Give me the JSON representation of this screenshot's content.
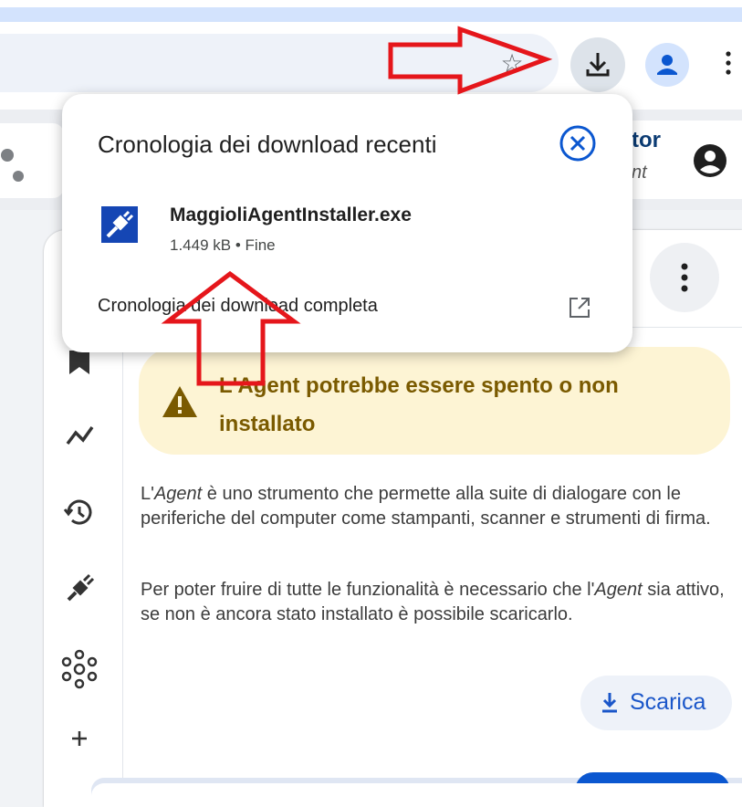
{
  "colors": {
    "accent_blue": "#1a56c9",
    "warning_bg": "#fdf4d4",
    "warning_text": "#7a5a00",
    "annotation_red": "#e5161b"
  },
  "toolbar": {
    "bookmark_icon": "star-outline-icon",
    "download_icon": "download-icon",
    "profile_icon": "person-icon",
    "menu_icon": "kebab-menu-icon"
  },
  "download_bubble": {
    "title": "Cronologia dei download recenti",
    "close_icon": "close-circle-icon",
    "file": {
      "name": "MaggioliAgentInstaller.exe",
      "size": "1.449 kB",
      "separator": "•",
      "status": "Fine"
    },
    "history_link": "Cronologia dei download completa",
    "open_icon": "open-in-new-icon"
  },
  "page": {
    "header_title": "tor",
    "header_subtitle": "nt",
    "warning": "L'Agent potrebbe essere spento o non installato",
    "description_1": {
      "pre": "L'",
      "em": "Agent",
      "post": " è uno strumento che permette alla suite di dialogare con le periferiche del computer come stampanti, scanner e strumenti di firma."
    },
    "description_2": {
      "pre": "Per poter fruire di tutte le funzionalità è necessario che l'",
      "em": "Agent",
      "post": " sia attivo, se non è ancora stato installato è possibile scaricarlo."
    },
    "download_button": "Scarica",
    "rail_icons": [
      "bookmark-icon",
      "trending-icon",
      "history-icon",
      "plug-icon",
      "network-icon",
      "plus-icon"
    ]
  }
}
